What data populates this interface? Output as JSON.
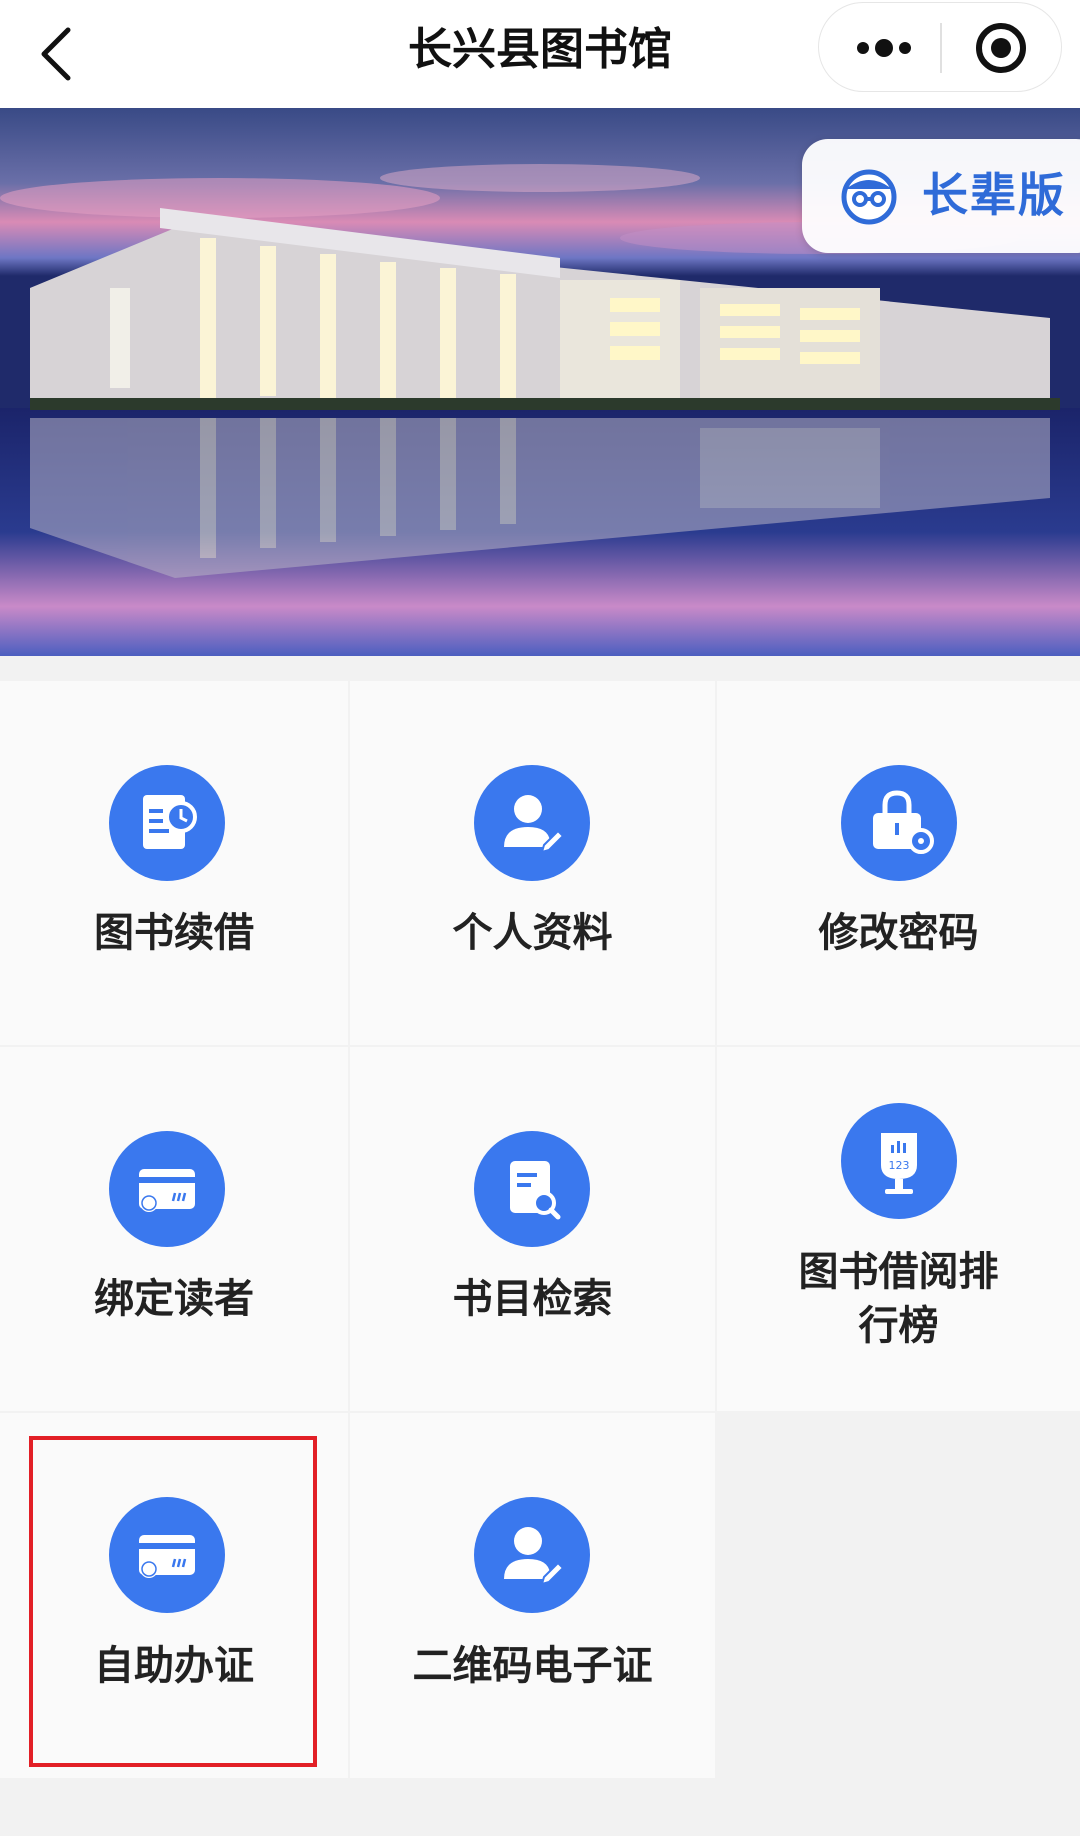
{
  "header": {
    "title": "长兴县图书馆"
  },
  "banner": {
    "elder_mode_label": "长辈版"
  },
  "menu": {
    "items": [
      {
        "label": "图书续借",
        "icon": "book-renew-icon"
      },
      {
        "label": "个人资料",
        "icon": "profile-icon"
      },
      {
        "label": "修改密码",
        "icon": "lock-settings-icon"
      },
      {
        "label": "绑定读者",
        "icon": "bind-card-icon"
      },
      {
        "label": "书目检索",
        "icon": "document-search-icon"
      },
      {
        "label": "图书借阅排行榜",
        "icon": "ranking-trophy-icon"
      },
      {
        "label": "自助办证",
        "icon": "bind-card-icon"
      },
      {
        "label": "二维码电子证",
        "icon": "profile-icon"
      }
    ]
  },
  "colors": {
    "accent": "#3a78ee",
    "highlight_border": "#e21f26",
    "elder_label": "#2f6bd8"
  }
}
